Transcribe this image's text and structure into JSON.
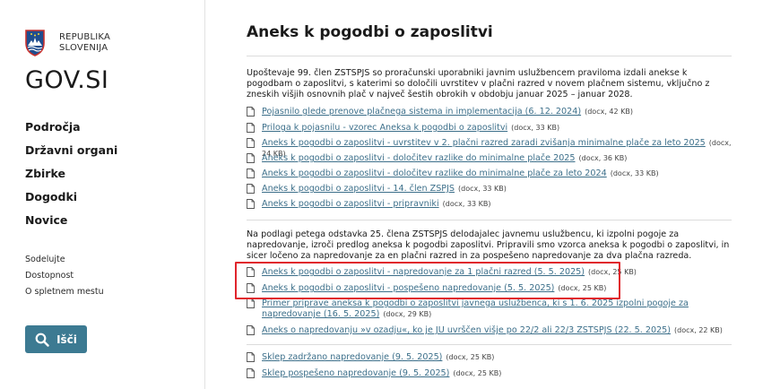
{
  "sidebar": {
    "republic_line1": "REPUBLIKA",
    "republic_line2": "SLOVENIJA",
    "site_name": "GOV.SI",
    "main_nav": [
      "Področja",
      "Državni organi",
      "Zbirke",
      "Dogodki",
      "Novice"
    ],
    "secondary_nav": [
      "Sodelujte",
      "Dostopnost",
      "O spletnem mestu"
    ],
    "search_label": "Išči"
  },
  "main": {
    "title": "Aneks k pogodbi o zaposlitvi",
    "intro1": "Upoštevaje 99. člen ZSTSPJS so proračunski uporabniki javnim uslužbencem praviloma izdali anekse k pogodbam o zaposlitvi, s katerimi so določili uvrstitev v plačni razred v novem plačnem sistemu, vključno z zneskih višjih osnovnih plač v največ šestih obrokih v obdobju januar 2025 – januar 2028.",
    "docs1": [
      {
        "title": "Pojasnilo glede prenove plačnega sistema in implementacija (6. 12. 2024)",
        "meta": "(docx, 42 KB)"
      },
      {
        "title": "Priloga k pojasnilu - vzorec Aneksa k pogodbi o zaposlitvi",
        "meta": "(docx, 33 KB)"
      },
      {
        "title": "Aneks k pogodbi o zaposlitvi - uvrstitev v 2. plačni razred zaradi zvišanja minimalne plače za leto 2025",
        "meta": "(docx, 24 KB)"
      },
      {
        "title": "Aneks k pogodbi o zaposlitvi - določitev razlike do minimalne plače 2025",
        "meta": "(docx, 36 KB)"
      },
      {
        "title": "Aneks k pogodbi o zaposlitvi - določitev razlike do minimalne plače za leto 2024",
        "meta": "(docx, 33 KB)"
      },
      {
        "title": "Aneks k pogodbi o zaposlitvi - 14. člen ZSPJS",
        "meta": "(docx, 33 KB)"
      },
      {
        "title": "Aneks k pogodbi o zaposlitvi - pripravniki",
        "meta": "(docx, 33 KB)"
      }
    ],
    "intro2": "Na podlagi petega odstavka 25. člena ZSTSPJS delodajalec javnemu uslužbencu, ki izpolni pogoje za napredovanje, izroči predlog aneksa k pogodbi zaposlitvi. Pripravili smo vzorca aneksa k pogodbi o zaposlitvi, in sicer ločeno za napredovanje za en plačni razred in za pospešeno napredovanje za dva plačna razreda.",
    "docs2": [
      {
        "title": "Aneks k pogodbi o zaposlitvi - napredovanje za 1 plačni razred (5. 5. 2025)",
        "meta": "(docx, 25 KB)"
      },
      {
        "title": "Aneks k pogodbi o zaposlitvi - pospešeno napredovanje (5. 5. 2025)",
        "meta": "(docx, 25 KB)"
      },
      {
        "title": "Primer priprave aneksa k pogodbi o zaposlitvi javnega uslužbenca, ki s 1. 6. 2025 izpolni pogoje za napredovanje (16. 5. 2025)",
        "meta": "(docx, 29 KB)"
      },
      {
        "title": "Aneks o napredovanju »v ozadju«, ko je JU uvrščen višje po 22/2 ali 22/3 ZSTSPJS (22. 5. 2025)",
        "meta": "(docx, 22 KB)"
      }
    ],
    "docs3": [
      {
        "title": "Sklep zadržano napredovanje (9. 5. 2025)",
        "meta": "(docx, 25 KB)"
      },
      {
        "title": "Sklep pospešeno napredovanje (9. 5. 2025)",
        "meta": "(docx, 25 KB)"
      }
    ]
  },
  "colors": {
    "link": "#3c6f8a",
    "search_button": "#3c7a92",
    "highlight": "#e0242c"
  }
}
